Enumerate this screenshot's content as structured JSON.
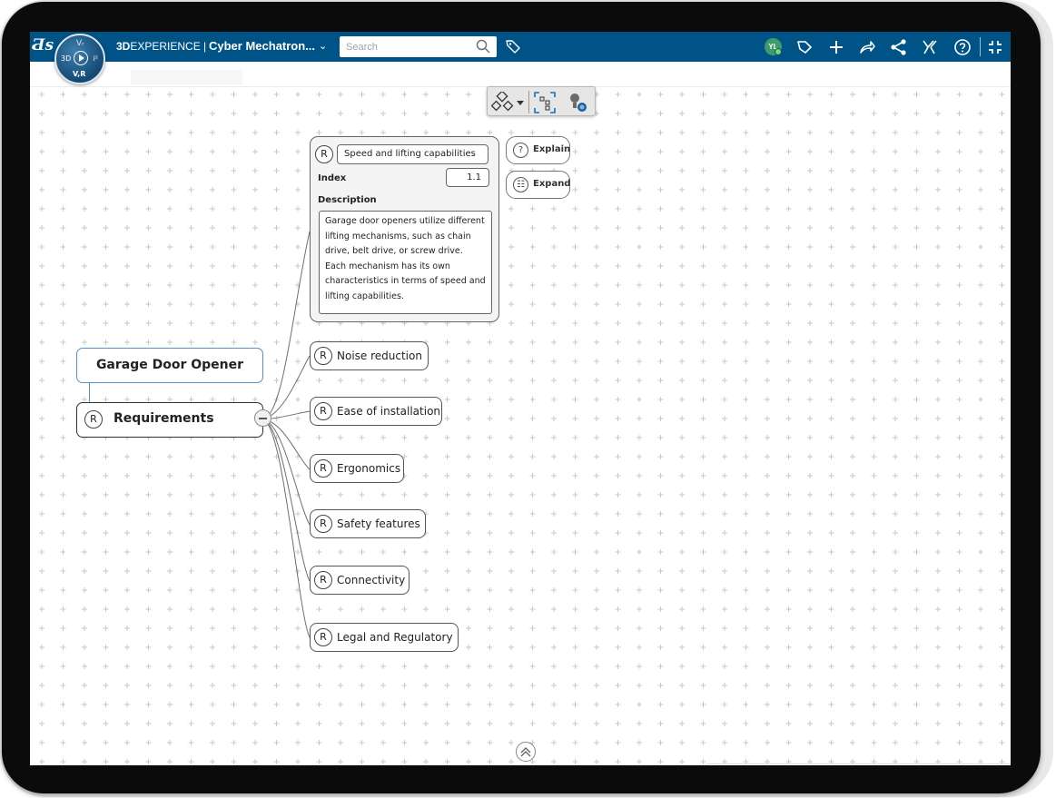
{
  "topbar": {
    "brand_bold": "3D",
    "brand_rest": "EXPERIENCE",
    "brand_sep": "|",
    "context_title": "Cyber Mechatron...",
    "search_placeholder": "Search",
    "user_initials": "YL",
    "compass": {
      "top": "Vᵣ",
      "left": "3D",
      "right": "i²",
      "bottom": "V,R"
    }
  },
  "mindmap": {
    "root": "Garage Door Opener",
    "parent": {
      "badge": "R",
      "label": "Requirements"
    },
    "expanded": {
      "badge": "R",
      "title": "Speed and lifting capabilities",
      "index_label": "Index",
      "index_value": "1.1",
      "description_label": "Description",
      "description": "Garage door openers utilize different lifting mechanisms, such as chain drive, belt drive, or screw drive. Each mechanism has its own characteristics in terms of speed and lifting capabilities."
    },
    "actions": {
      "explain": "Explain",
      "expand": "Expand"
    },
    "children": [
      {
        "badge": "R",
        "label": "Noise reduction"
      },
      {
        "badge": "R",
        "label": "Ease of installation"
      },
      {
        "badge": "R",
        "label": "Ergonomics"
      },
      {
        "badge": "R",
        "label": "Safety features"
      },
      {
        "badge": "R",
        "label": "Connectivity"
      },
      {
        "badge": "R",
        "label": "Legal and Regulatory"
      }
    ]
  },
  "colors": {
    "header": "#005386",
    "root_border": "#5b8fc7",
    "avatar": "#3f9c6a"
  }
}
